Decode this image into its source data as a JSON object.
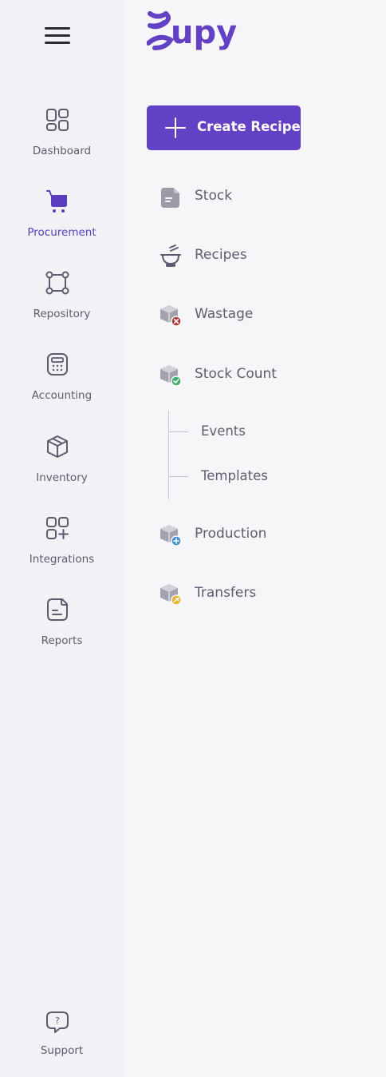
{
  "brand": {
    "name": "Supy",
    "logo_text": "upy",
    "accent": "#6241c4"
  },
  "rail": {
    "menu_icon": "hamburger-icon",
    "items": [
      {
        "label": "Dashboard",
        "icon": "dashboard-icon",
        "active": false
      },
      {
        "label": "Procurement",
        "icon": "cart-icon",
        "active": true
      },
      {
        "label": "Repository",
        "icon": "repository-icon",
        "active": false
      },
      {
        "label": "Accounting",
        "icon": "calculator-icon",
        "active": false
      },
      {
        "label": "Inventory",
        "icon": "box-icon",
        "active": false
      },
      {
        "label": "Integrations",
        "icon": "integrations-icon",
        "active": false
      },
      {
        "label": "Reports",
        "icon": "reports-icon",
        "active": false
      }
    ],
    "support": {
      "label": "Support",
      "icon": "help-chat-icon"
    }
  },
  "main": {
    "create_button": {
      "label": "Create Recipe",
      "icon": "plus-icon"
    },
    "nav": [
      {
        "label": "Stock",
        "icon": "document-icon"
      },
      {
        "label": "Recipes",
        "icon": "bowl-icon"
      },
      {
        "label": "Wastage",
        "icon": "box-remove-icon"
      },
      {
        "label": "Stock Count",
        "icon": "box-check-icon"
      },
      {
        "label": "Production",
        "icon": "box-add-icon"
      },
      {
        "label": "Transfers",
        "icon": "box-transfer-icon"
      }
    ],
    "stock_count_sub": [
      {
        "label": "Events"
      },
      {
        "label": "Templates"
      }
    ]
  }
}
